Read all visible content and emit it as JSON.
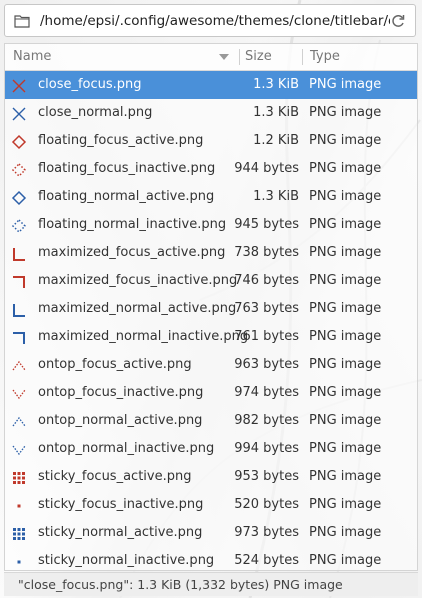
{
  "pathbar": {
    "path": "/home/epsi/.config/awesome/themes/clone/titlebar/clone/"
  },
  "columns": {
    "name": "Name",
    "size": "Size",
    "type": "Type"
  },
  "files": [
    {
      "name": "close_focus.png",
      "size": "1.3 KiB",
      "type": "PNG image",
      "icon": "close-x-icon",
      "selected": true
    },
    {
      "name": "close_normal.png",
      "size": "1.3 KiB",
      "type": "PNG image",
      "icon": "close-x-icon"
    },
    {
      "name": "floating_focus_active.png",
      "size": "1.2 KiB",
      "type": "PNG image",
      "icon": "diamond-icon"
    },
    {
      "name": "floating_focus_inactive.png",
      "size": "944 bytes",
      "type": "PNG image",
      "icon": "dotted-diamond-icon"
    },
    {
      "name": "floating_normal_active.png",
      "size": "1.3 KiB",
      "type": "PNG image",
      "icon": "diamond-icon"
    },
    {
      "name": "floating_normal_inactive.png",
      "size": "945 bytes",
      "type": "PNG image",
      "icon": "dotted-diamond-icon"
    },
    {
      "name": "maximized_focus_active.png",
      "size": "738 bytes",
      "type": "PNG image",
      "icon": "corner-bottom-left-icon"
    },
    {
      "name": "maximized_focus_inactive.png",
      "size": "746 bytes",
      "type": "PNG image",
      "icon": "corner-top-right-icon"
    },
    {
      "name": "maximized_normal_active.png",
      "size": "763 bytes",
      "type": "PNG image",
      "icon": "corner-bottom-left-icon"
    },
    {
      "name": "maximized_normal_inactive.png",
      "size": "761 bytes",
      "type": "PNG image",
      "icon": "corner-top-right-icon"
    },
    {
      "name": "ontop_focus_active.png",
      "size": "963 bytes",
      "type": "PNG image",
      "icon": "chevron-up-icon"
    },
    {
      "name": "ontop_focus_inactive.png",
      "size": "974 bytes",
      "type": "PNG image",
      "icon": "chevron-down-icon"
    },
    {
      "name": "ontop_normal_active.png",
      "size": "982 bytes",
      "type": "PNG image",
      "icon": "chevron-up-icon"
    },
    {
      "name": "ontop_normal_inactive.png",
      "size": "994 bytes",
      "type": "PNG image",
      "icon": "chevron-down-icon"
    },
    {
      "name": "sticky_focus_active.png",
      "size": "953 bytes",
      "type": "PNG image",
      "icon": "grid-icon"
    },
    {
      "name": "sticky_focus_inactive.png",
      "size": "520 bytes",
      "type": "PNG image",
      "icon": "dot-icon"
    },
    {
      "name": "sticky_normal_active.png",
      "size": "973 bytes",
      "type": "PNG image",
      "icon": "grid-icon"
    },
    {
      "name": "sticky_normal_inactive.png",
      "size": "524 bytes",
      "type": "PNG image",
      "icon": "dot-icon"
    }
  ],
  "colors": {
    "focus": "#c0392b",
    "normal": "#2c5fa8",
    "selection": "#4a90d9"
  },
  "statusbar": {
    "text": "\"close_focus.png\": 1.3 KiB (1,332 bytes) PNG image"
  }
}
